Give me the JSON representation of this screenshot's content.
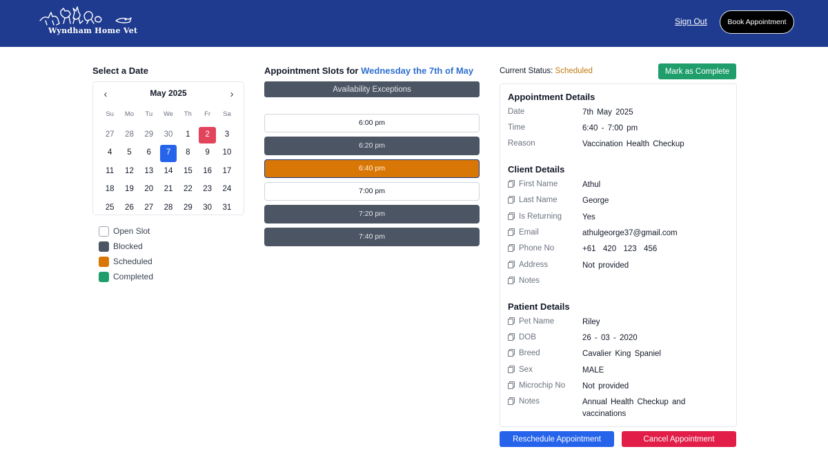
{
  "header": {
    "brand": "Wyndham Home Vet",
    "sign_out": "Sign Out",
    "book_appointment": "Book Appointment"
  },
  "calendar": {
    "title": "Select a Date",
    "month": "May 2025",
    "weekdays": [
      "Su",
      "Mo",
      "Tu",
      "We",
      "Th",
      "Fr",
      "Sa"
    ],
    "days": [
      {
        "label": "27",
        "muted": true
      },
      {
        "label": "28",
        "muted": true
      },
      {
        "label": "29",
        "muted": true
      },
      {
        "label": "30",
        "muted": true
      },
      {
        "label": "1"
      },
      {
        "label": "2",
        "today": true
      },
      {
        "label": "3"
      },
      {
        "label": "4"
      },
      {
        "label": "5"
      },
      {
        "label": "6"
      },
      {
        "label": "7",
        "selected": true
      },
      {
        "label": "8"
      },
      {
        "label": "9"
      },
      {
        "label": "10"
      },
      {
        "label": "11"
      },
      {
        "label": "12"
      },
      {
        "label": "13"
      },
      {
        "label": "14"
      },
      {
        "label": "15"
      },
      {
        "label": "16"
      },
      {
        "label": "17"
      },
      {
        "label": "18"
      },
      {
        "label": "19"
      },
      {
        "label": "20"
      },
      {
        "label": "21"
      },
      {
        "label": "22"
      },
      {
        "label": "23"
      },
      {
        "label": "24"
      },
      {
        "label": "25"
      },
      {
        "label": "26"
      },
      {
        "label": "27"
      },
      {
        "label": "28"
      },
      {
        "label": "29"
      },
      {
        "label": "30"
      },
      {
        "label": "31"
      }
    ]
  },
  "legend": [
    {
      "label": "Open Slot",
      "color": "#ffffff",
      "border": "#9ca3af"
    },
    {
      "label": "Blocked",
      "color": "#4b5563",
      "border": "#4b5563"
    },
    {
      "label": "Scheduled",
      "color": "#d97706",
      "border": "#d97706"
    },
    {
      "label": "Completed",
      "color": "#1f9d6b",
      "border": "#1f9d6b"
    }
  ],
  "slots": {
    "title_prefix": "Appointment Slots for",
    "title_date": "Wednesday the 7th of May",
    "exceptions": "Availability Exceptions",
    "items": [
      {
        "time": "6:00 pm",
        "state": "open"
      },
      {
        "time": "6:20 pm",
        "state": "blocked"
      },
      {
        "time": "6:40 pm",
        "state": "scheduled"
      },
      {
        "time": "7:00 pm",
        "state": "open"
      },
      {
        "time": "7:20 pm",
        "state": "blocked"
      },
      {
        "time": "7:40 pm",
        "state": "blocked"
      }
    ]
  },
  "status": {
    "label": "Current Status:",
    "value": "Scheduled",
    "mark_complete": "Mark as Complete"
  },
  "appointment": {
    "title": "Appointment Details",
    "date_label": "Date",
    "date": "7th May 2025",
    "time_label": "Time",
    "time": "6:40 - 7:00 pm",
    "reason_label": "Reason",
    "reason": "Vaccination  Health Checkup"
  },
  "client": {
    "title": "Client Details",
    "first_name_label": "First Name",
    "first_name": "Athul",
    "last_name_label": "Last Name",
    "last_name": "George",
    "returning_label": "Is Returning",
    "returning": "Yes",
    "email_label": "Email",
    "email": "athulgeorge37@gmail.com",
    "phone_label": "Phone No",
    "phone": "+61  420  123  456",
    "address_label": "Address",
    "address": "Not provided",
    "notes_label": "Notes",
    "notes": ""
  },
  "patient": {
    "title": "Patient Details",
    "pet_name_label": "Pet Name",
    "pet_name": "Riley",
    "dob_label": "DOB",
    "dob": "26 - 03 - 2020",
    "breed_label": "Breed",
    "breed": "Cavalier King Spaniel",
    "sex_label": "Sex",
    "sex": "MALE",
    "microchip_label": "Microchip No",
    "microchip": "Not provided",
    "notes_label": "Notes",
    "notes": "Annual Health Checkup and vaccinations"
  },
  "actions": {
    "reschedule": "Reschedule Appointment",
    "cancel": "Cancel Appointment"
  }
}
